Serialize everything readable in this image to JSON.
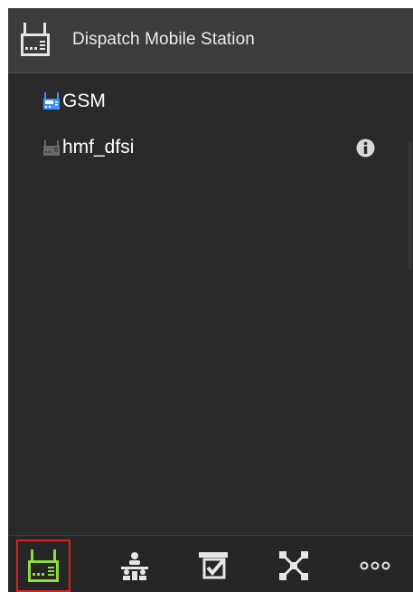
{
  "header": {
    "title": "Dispatch Mobile Station",
    "icon": "radio-station-icon"
  },
  "list": {
    "items": [
      {
        "label": "GSM",
        "icon": "radio-station-icon",
        "icon_color": "#3f8fff",
        "status": "online"
      },
      {
        "label": "hmf_dfsi",
        "icon": "radio-station-icon",
        "icon_color": "#707070",
        "status": "offline",
        "trailing_icon": "info-icon"
      }
    ]
  },
  "tabbar": {
    "tabs": [
      {
        "name": "mobile-station",
        "icon": "radio-station-icon",
        "active": true,
        "color": "#8fdc3c"
      },
      {
        "name": "groups",
        "icon": "group-icon",
        "active": false
      },
      {
        "name": "checklist",
        "icon": "checkbox-icon",
        "active": false
      },
      {
        "name": "network",
        "icon": "network-icon",
        "active": false
      },
      {
        "name": "more",
        "icon": "more-icon",
        "active": false
      }
    ]
  },
  "colors": {
    "background": "#2a2a2a",
    "header": "#3c3c3c",
    "active_tab_border": "#e02020",
    "active_icon": "#8fdc3c",
    "online_icon": "#3f8fff"
  }
}
